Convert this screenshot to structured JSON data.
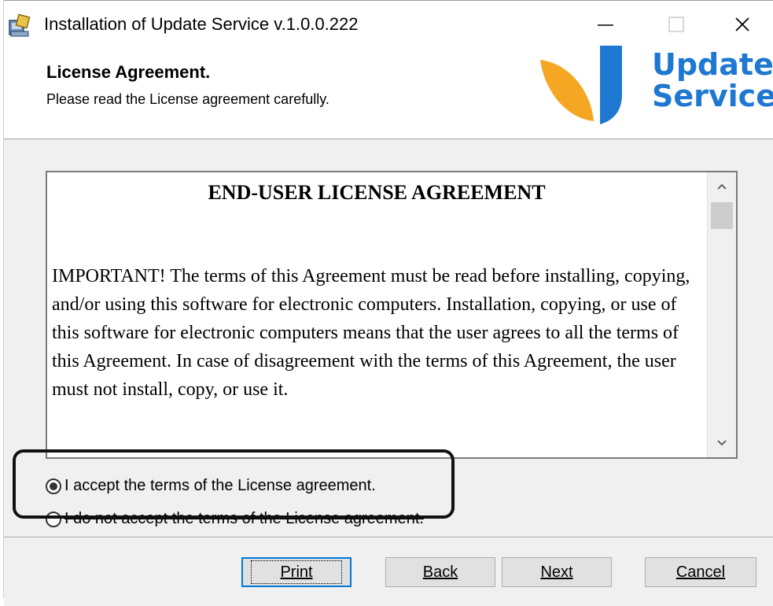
{
  "window": {
    "title": "Installation of Update Service v.1.0.0.222",
    "minimize_label": "—",
    "close_label": "✕"
  },
  "header": {
    "title": "License Agreement.",
    "subtitle": "Please read the License agreement carefully.",
    "logo_line1": "Update",
    "logo_line2": "Service"
  },
  "license": {
    "heading": "END-USER LICENSE AGREEMENT",
    "paragraph": "IMPORTANT! The terms of this Agreement must be read before installing, copying, and/or using this software for electronic computers. Installation, copying, or use of this software for electronic computers means that the user agrees to all the terms of this Agreement. In case of disagreement with the terms of this Agreement, the user must not install, copy, or use it."
  },
  "options": {
    "accept_label": "I accept the terms of the License agreement.",
    "decline_label": "I do not accept the terms of the License agreement.",
    "selected": "accept"
  },
  "buttons": {
    "print_label": "Print",
    "back_label": "Back",
    "next_label": "Next",
    "cancel_label": "Cancel"
  },
  "colors": {
    "logo_blue": "#1e78d2",
    "logo_orange": "#f5a623",
    "focus_blue": "#0078d7"
  }
}
